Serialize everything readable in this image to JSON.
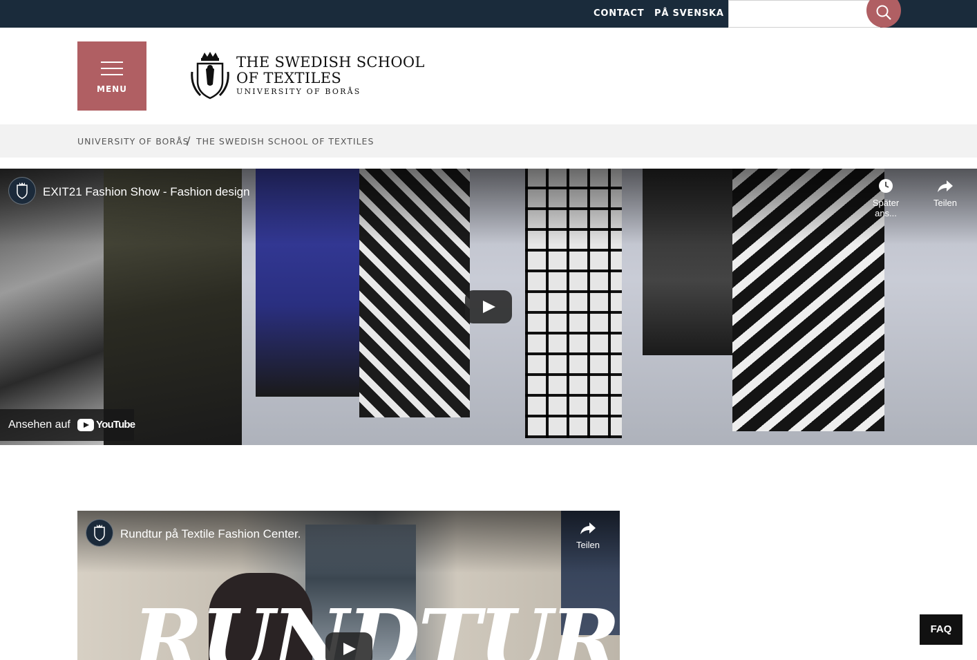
{
  "topbar": {
    "contact_label": "CONTACT",
    "language_label": "PÅ SVENSKA",
    "search_placeholder": "",
    "search_icon": "search-icon"
  },
  "header": {
    "menu_label": "MENU",
    "logo_line1": "THE SWEDISH SCHOOL",
    "logo_line2": "OF TEXTILES",
    "logo_line3": "UNIVERSITY OF BORÅS"
  },
  "breadcrumb": {
    "items": [
      "UNIVERSITY OF BORÅS",
      "THE SWEDISH SCHOOL OF TEXTILES"
    ],
    "separator": "/"
  },
  "video1": {
    "title": "EXIT21 Fashion Show - Fashion design",
    "watch_later_label": "Später ans...",
    "share_label": "Teilen",
    "watch_on_label": "Ansehen auf",
    "youtube_label": "YouTube"
  },
  "video2": {
    "title": "Rundtur på Textile Fashion Center.",
    "share_label": "Teilen",
    "overlay_text": "RUNDTUR"
  },
  "faq": {
    "label": "FAQ"
  },
  "colors": {
    "topbar": "#1a2b3b",
    "accent": "#b05f63",
    "breadcrumb_bg": "#f2f2f2",
    "faq_bg": "#111111"
  }
}
